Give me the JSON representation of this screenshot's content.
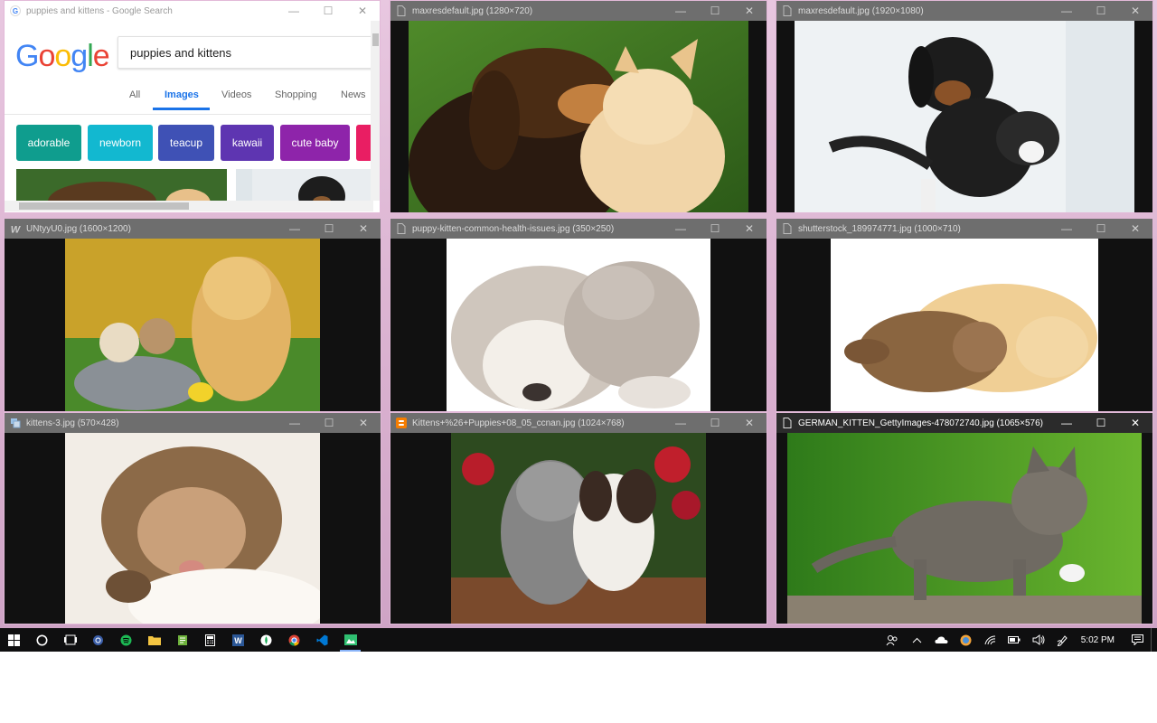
{
  "search_window": {
    "title": "puppies and kittens - Google Search",
    "logo": "Google",
    "query": "puppies and kittens",
    "tabs": [
      "All",
      "Images",
      "Videos",
      "Shopping",
      "News"
    ],
    "selected_tab": "Images",
    "chips": [
      {
        "label": "adorable",
        "color": "#0f9d8e"
      },
      {
        "label": "newborn",
        "color": "#12b8d0"
      },
      {
        "label": "teacup",
        "color": "#3f51b5"
      },
      {
        "label": "kawaii",
        "color": "#5e35b1"
      },
      {
        "label": "cute baby",
        "color": "#8e24aa"
      },
      {
        "label": "",
        "color": "#e91e63"
      }
    ]
  },
  "viewer_windows": [
    {
      "title": "maxresdefault.jpg (1280×720)",
      "icon": "image-file-icon"
    },
    {
      "title": "maxresdefault.jpg (1920×1080)",
      "icon": "image-file-icon"
    },
    {
      "title": "UNtyyU0.jpg (1600×1200)",
      "icon": "w-logo-icon"
    },
    {
      "title": "puppy-kitten-common-health-issues.jpg (350×250)",
      "icon": "image-file-icon"
    },
    {
      "title": "shutterstock_189974771.jpg (1000×710)",
      "icon": "image-file-icon"
    },
    {
      "title": "kittens-3.jpg (570×428)",
      "icon": "image-stack-icon"
    },
    {
      "title": "Kittens+%26+Puppies+08_05_ccnan.jpg (1024×768)",
      "icon": "blogger-icon"
    },
    {
      "title": "GERMAN_KITTEN_GettyImages-478072740.jpg (1065×576)",
      "icon": "image-file-icon"
    }
  ],
  "window_controls": {
    "minimize": "—",
    "maximize": "☐",
    "close": "✕"
  },
  "taskbar": {
    "icons": [
      "start-icon",
      "cortana-icon",
      "task-view-icon",
      "settings-icon",
      "spotify-icon",
      "file-explorer-icon",
      "notepad-icon",
      "calculator-icon",
      "word-icon",
      "mongodb-icon",
      "chrome-icon",
      "vscode-icon",
      "image-viewer-icon"
    ],
    "clock": "5:02 PM"
  },
  "colors": {
    "desktop": "#d9b0cf",
    "titlebar_inactive": "#6e6e6e",
    "titlebar_active": "#2b2b2b",
    "taskbar": "#0f0f10",
    "google_blue": "#1a73e8"
  }
}
